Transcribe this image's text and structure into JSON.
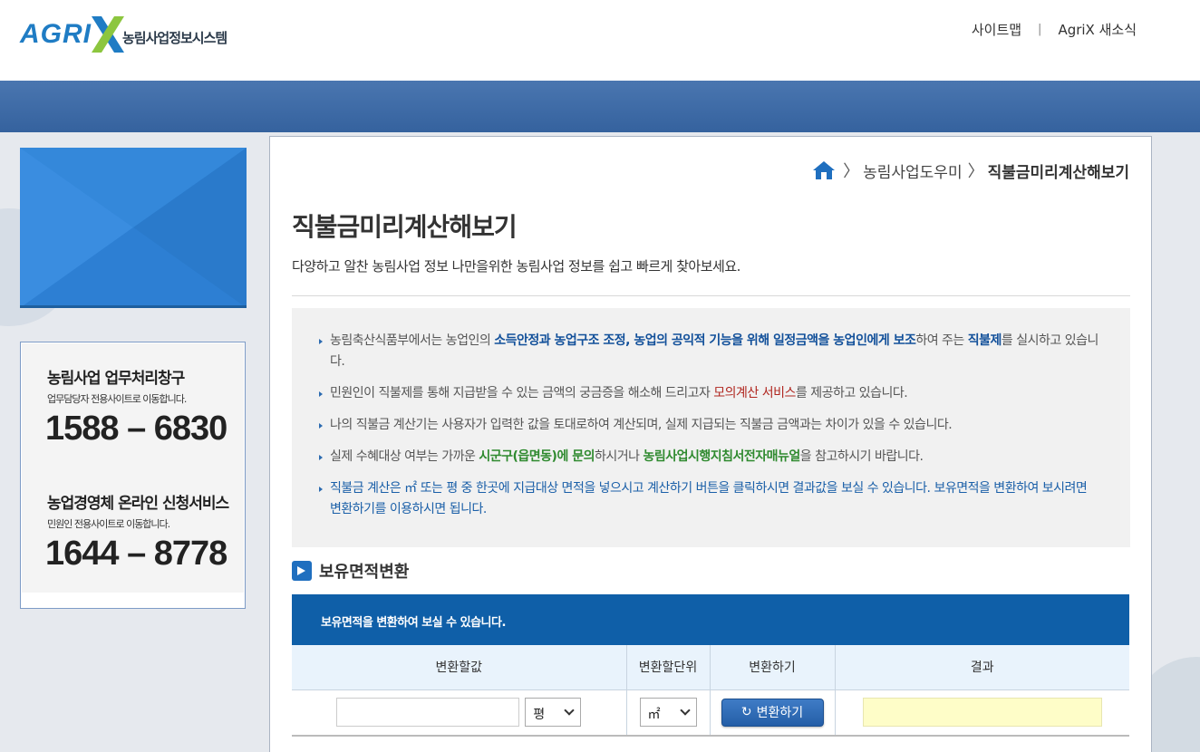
{
  "header": {
    "logo_text": "AGRI",
    "logo_sub": "농림사업정보시스템",
    "links": [
      "사이트맵",
      "AgriX 새소식"
    ]
  },
  "breadcrumb": {
    "items": [
      "농림사업도우미",
      "직불금미리계산해보기"
    ]
  },
  "page": {
    "title": "직불금미리계산해보기",
    "description": "다양하고 알찬 농림사업 정보 나만을위한 농림사업 정보를 쉽고 빠르게 찾아보세요."
  },
  "notice": {
    "item1": {
      "a": "농림축산식품부에서는 농업인의 ",
      "b": "소득안정과 농업구조 조정, 농업의 공익적 기능을 위해 일정금액을 농업인에게 보조",
      "c": "하여 주는 ",
      "d": "직불제",
      "e": "를 실시하고 있습니다."
    },
    "item2": {
      "a": "민원인이 직불제를 통해 지급받을 수 있는 금액의 궁금증을 해소해 드리고자 ",
      "b": "모의계산 서비스",
      "c": "를 제공하고 있습니다."
    },
    "item3": "나의 직불금 계산기는 사용자가 입력한 값을 토대로하여 계산되며, 실제 지급되는 직불금 금액과는 차이가 있을 수 있습니다.",
    "item4": {
      "a": "실제 수혜대상 여부는 가까운 ",
      "b": "시군구(읍면동)에 문의",
      "c": "하시거나 ",
      "d": "농림사업시행지침서전자매뉴얼",
      "e": "을 참고하시기 바랍니다."
    },
    "item5": "직불금 계산은 ㎡ 또는 평 중 한곳에 지급대상 면적을 넣으시고 계산하기 버튼을 클릭하시면 결과값을 보실 수 있습니다. 보유면적을 변환하여 보시려면 변환하기를 이용하시면 됩니다."
  },
  "converter": {
    "section_title": "보유면적변환",
    "caption": "보유면적을 변환하여 보실 수 있습니다.",
    "columns": [
      "변환할값",
      "변환할단위",
      "변환하기",
      "결과"
    ],
    "input_value": "",
    "from_unit": "평",
    "to_unit": "㎡",
    "button_label": "변환하기",
    "result": ""
  },
  "sidebar": {
    "contact1": {
      "title": "농림사업 업무처리창구",
      "sub": "업무담당자 전용사이트로 이동합니다.",
      "phone": "1588 – 6830"
    },
    "contact2": {
      "title": "농업경영체 온라인 신청서비스",
      "sub": "민원인 전용사이트로 이동합니다.",
      "phone": "1644 – 8778"
    }
  },
  "colors": {
    "brand_blue": "#1f7cc4",
    "logo_green": "#8cc63f",
    "nav_bar": "#3f6ca8",
    "table_header": "#0f5fa8",
    "result_bg": "#fefdc8"
  }
}
